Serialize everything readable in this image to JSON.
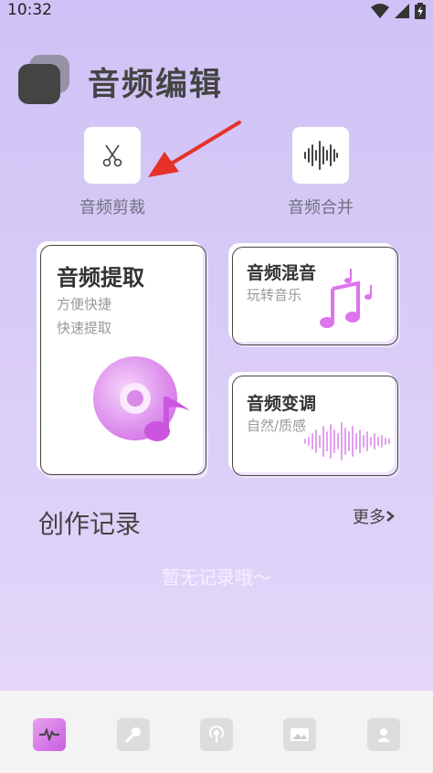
{
  "status": {
    "time": "10:32"
  },
  "app": {
    "title": "音频编辑"
  },
  "tools": [
    {
      "label": "音频剪裁",
      "icon": "scissors-icon"
    },
    {
      "label": "音频合并",
      "icon": "waveform-icon"
    }
  ],
  "cards": {
    "extract": {
      "title": "音频提取",
      "sub1": "方便快捷",
      "sub2": "快速提取"
    },
    "mix": {
      "title": "音频混音",
      "sub": "玩转音乐"
    },
    "pitch": {
      "title": "音频变调",
      "sub": "自然/质感"
    }
  },
  "records": {
    "title": "创作记录",
    "more": "更多",
    "empty": "暂无记录哦～"
  },
  "nav": [
    "waveform-icon",
    "microphone-icon",
    "podcast-icon",
    "image-icon",
    "user-icon"
  ],
  "colors": {
    "accent": "#d86fe6",
    "background": "#d6c9f6"
  }
}
